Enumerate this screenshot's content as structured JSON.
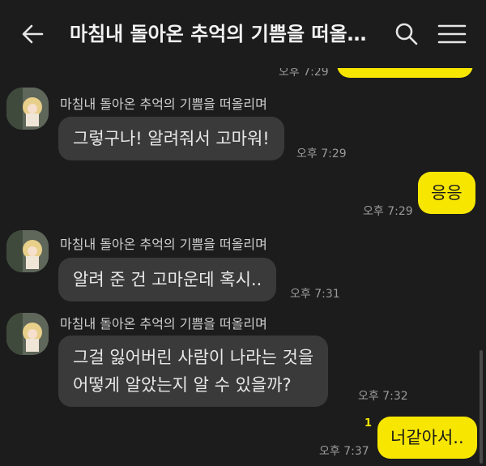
{
  "header": {
    "title": "마침내 돌아온 추억의 기쁨을 떠올리며",
    "back_icon": "arrow-left-icon",
    "search_icon": "search-icon",
    "menu_icon": "menu-icon"
  },
  "colors": {
    "background": "#1c1c1c",
    "incoming_bubble": "#3a3a3a",
    "outgoing_bubble": "#f7e600",
    "unread_count": "#f7e600"
  },
  "messages": {
    "top_partial_time": "오후 7:29",
    "m1_sender": "마침내 돌아온 추억의 기쁨을 떠올리며",
    "m1_text": "그렇구나! 알려줘서 고마워!",
    "m1_time": "오후 7:29",
    "m2_text": "응응",
    "m2_time": "오후 7:29",
    "m3_sender": "마침내 돌아온 추억의 기쁨을 떠올리며",
    "m3_text": "알려 준 건 고마운데 혹시..",
    "m3_time": "오후 7:31",
    "m4_sender": "마침내 돌아온 추억의 기쁨을 떠올리며",
    "m4_line1": "그걸 잃어버린 사람이 나라는 것을",
    "m4_line2": "어떻게 알았는지 알 수 있을까?",
    "m4_time": "오후 7:32",
    "m5_unread": "1",
    "m5_text": "너같아서..",
    "m5_time": "오후 7:37"
  }
}
